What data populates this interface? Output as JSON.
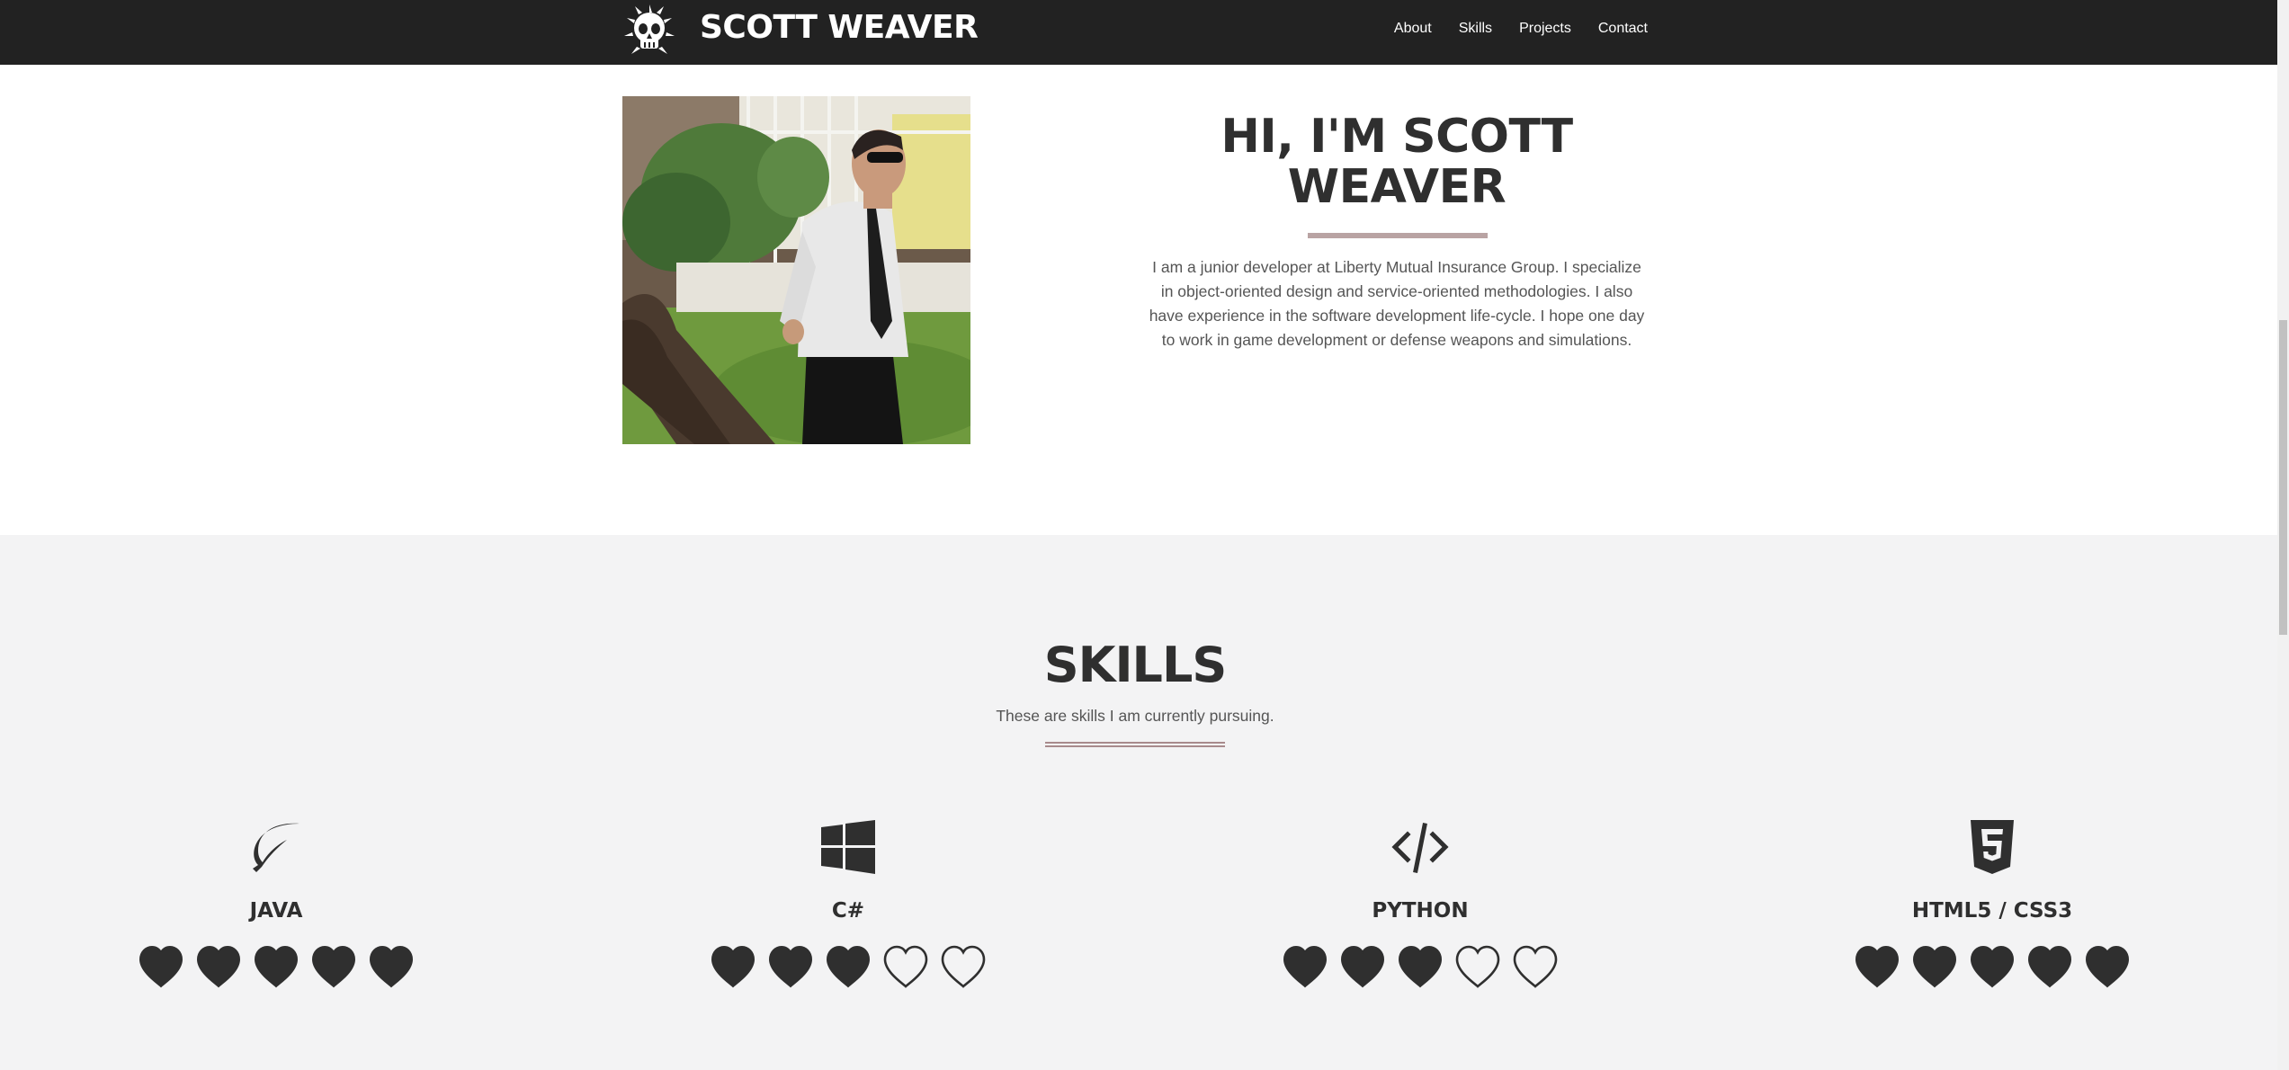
{
  "nav": {
    "logo_icon": "skull-icon",
    "brand": "SCOTT WEAVER",
    "links": [
      "About",
      "Skills",
      "Projects",
      "Contact"
    ]
  },
  "about": {
    "title": "HI, I'M SCOTT WEAVER",
    "text": "I am a junior developer at Liberty Mutual Insurance Group. I specialize in object-oriented design and service-oriented methodologies. I also have experience in the software development life-cycle. I hope one day to work in game development or defense weapons and simulations.",
    "rule_color": "#b9a3a3"
  },
  "skills": {
    "title": "SKILLS",
    "subtitle": "These are skills I am currently pursuing.",
    "items": [
      {
        "name": "JAVA",
        "icon": "leaf-icon",
        "rating": 5,
        "max": 5
      },
      {
        "name": "C#",
        "icon": "windows-icon",
        "rating": 3,
        "max": 5
      },
      {
        "name": "PYTHON",
        "icon": "code-icon",
        "rating": 3,
        "max": 5
      },
      {
        "name": "HTML5 / CSS3",
        "icon": "html5-icon",
        "rating": 5,
        "max": 5
      }
    ]
  },
  "colors": {
    "nav_bg": "#222222",
    "text": "#2f2f2f",
    "skills_bg": "#f3f3f4",
    "accent_rule": "#a88a8c"
  }
}
